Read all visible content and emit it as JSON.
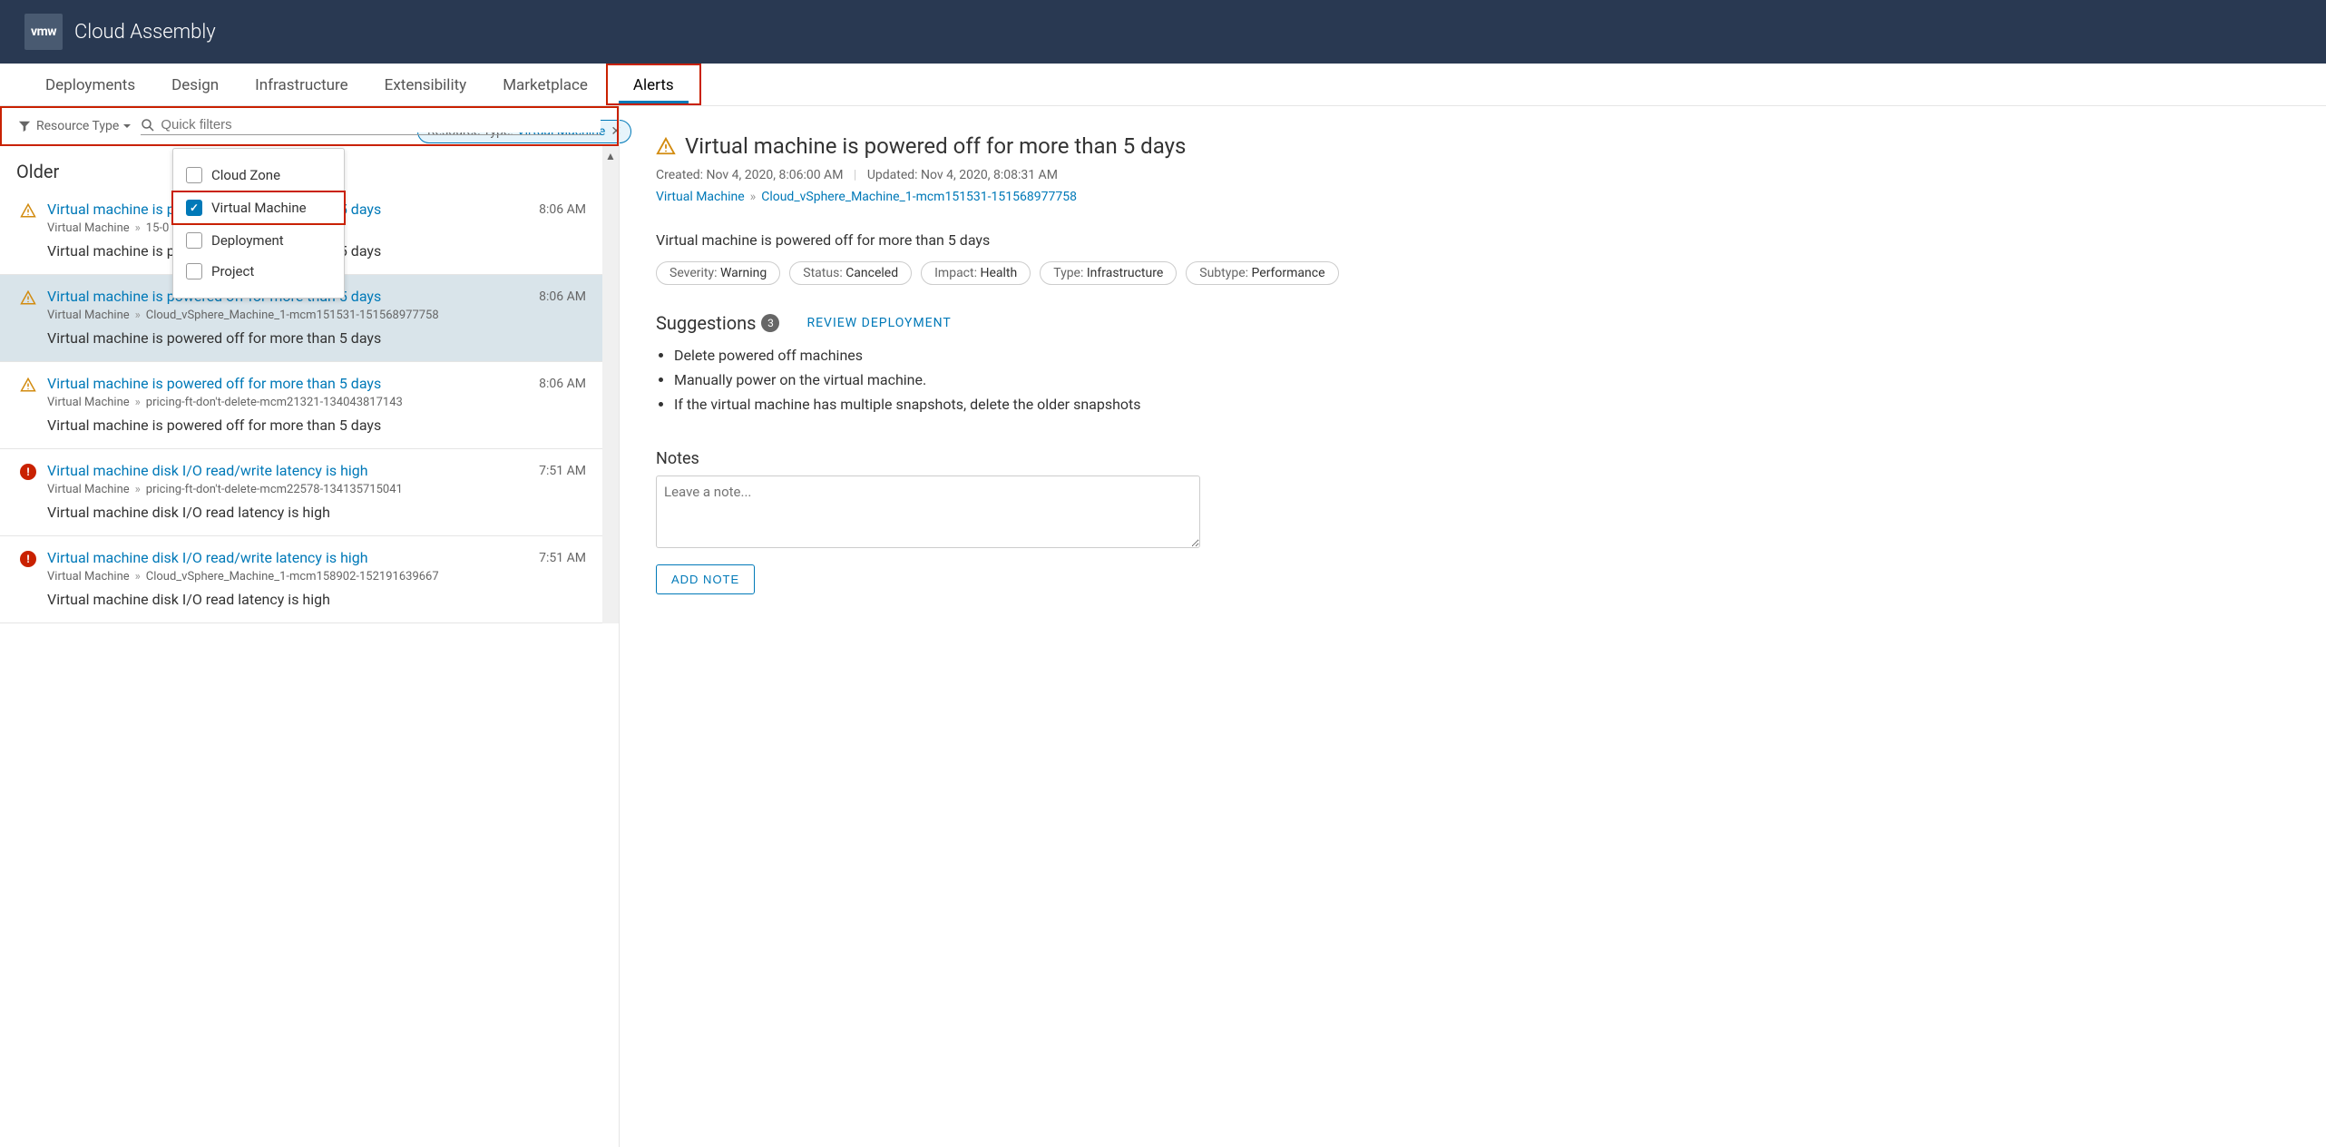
{
  "header": {
    "logo_text": "vmw",
    "app_title": "Cloud Assembly"
  },
  "nav": {
    "items": [
      "Deployments",
      "Design",
      "Infrastructure",
      "Extensibility",
      "Marketplace",
      "Alerts"
    ],
    "active_index": 5
  },
  "filter": {
    "dropdown_label": "Resource Type",
    "search_placeholder": "Quick filters",
    "chip": {
      "label": "Resource Type:",
      "value": "Virtual Machine"
    },
    "options": [
      {
        "label": "Cloud Zone",
        "checked": false
      },
      {
        "label": "Virtual Machine",
        "checked": true
      },
      {
        "label": "Deployment",
        "checked": false
      },
      {
        "label": "Project",
        "checked": false
      }
    ]
  },
  "list": {
    "section_header": "Older",
    "items": [
      {
        "severity": "warning",
        "title": "Virtual machine is powered off for more than 5 days",
        "bc_type": "Virtual Machine",
        "bc_name": "15-0",
        "desc": "Virtual machine is powered off for more than 5 days",
        "time": "8:06 AM",
        "selected": false
      },
      {
        "severity": "warning",
        "title": "Virtual machine is powered off for more than 5 days",
        "bc_type": "Virtual Machine",
        "bc_name": "Cloud_vSphere_Machine_1-mcm151531-151568977758",
        "desc": "Virtual machine is powered off for more than 5 days",
        "time": "8:06 AM",
        "selected": true
      },
      {
        "severity": "warning",
        "title": "Virtual machine is powered off for more than 5 days",
        "bc_type": "Virtual Machine",
        "bc_name": "pricing-ft-don't-delete-mcm21321-134043817143",
        "desc": "Virtual machine is powered off for more than 5 days",
        "time": "8:06 AM",
        "selected": false
      },
      {
        "severity": "critical",
        "title": "Virtual machine disk I/O read/write latency is high",
        "bc_type": "Virtual Machine",
        "bc_name": "pricing-ft-don't-delete-mcm22578-134135715041",
        "desc": "Virtual machine disk I/O read latency is high",
        "time": "7:51 AM",
        "selected": false
      },
      {
        "severity": "critical",
        "title": "Virtual machine disk I/O read/write latency is high",
        "bc_type": "Virtual Machine",
        "bc_name": "Cloud_vSphere_Machine_1-mcm158902-152191639667",
        "desc": "Virtual machine disk I/O read latency is high",
        "time": "7:51 AM",
        "selected": false
      }
    ]
  },
  "detail": {
    "title": "Virtual machine is powered off for more than 5 days",
    "created_label": "Created:",
    "created_value": "Nov 4, 2020, 8:06:00 AM",
    "updated_label": "Updated:",
    "updated_value": "Nov 4, 2020, 8:08:31 AM",
    "bc_type": "Virtual Machine",
    "bc_name": "Cloud_vSphere_Machine_1-mcm151531-151568977758",
    "desc": "Virtual machine is powered off for more than 5 days",
    "pills": [
      {
        "k": "Severity:",
        "v": "Warning"
      },
      {
        "k": "Status:",
        "v": "Canceled"
      },
      {
        "k": "Impact:",
        "v": "Health"
      },
      {
        "k": "Type:",
        "v": "Infrastructure"
      },
      {
        "k": "Subtype:",
        "v": "Performance"
      }
    ],
    "suggestions_label": "Suggestions",
    "suggestions_count": "3",
    "review_link": "REVIEW DEPLOYMENT",
    "suggestions": [
      "Delete powered off machines",
      "Manually power on the virtual machine.",
      "If the virtual machine has multiple snapshots, delete the older snapshots"
    ],
    "notes_label": "Notes",
    "notes_placeholder": "Leave a note...",
    "add_note_label": "ADD NOTE"
  }
}
